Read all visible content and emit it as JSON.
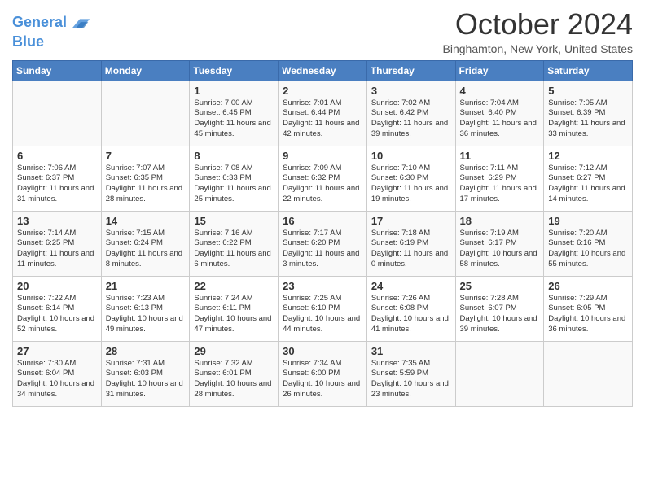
{
  "logo": {
    "line1": "General",
    "line2": "Blue"
  },
  "title": "October 2024",
  "location": "Binghamton, New York, United States",
  "weekdays": [
    "Sunday",
    "Monday",
    "Tuesday",
    "Wednesday",
    "Thursday",
    "Friday",
    "Saturday"
  ],
  "weeks": [
    [
      {
        "day": "",
        "info": ""
      },
      {
        "day": "",
        "info": ""
      },
      {
        "day": "1",
        "info": "Sunrise: 7:00 AM\nSunset: 6:45 PM\nDaylight: 11 hours and 45 minutes."
      },
      {
        "day": "2",
        "info": "Sunrise: 7:01 AM\nSunset: 6:44 PM\nDaylight: 11 hours and 42 minutes."
      },
      {
        "day": "3",
        "info": "Sunrise: 7:02 AM\nSunset: 6:42 PM\nDaylight: 11 hours and 39 minutes."
      },
      {
        "day": "4",
        "info": "Sunrise: 7:04 AM\nSunset: 6:40 PM\nDaylight: 11 hours and 36 minutes."
      },
      {
        "day": "5",
        "info": "Sunrise: 7:05 AM\nSunset: 6:39 PM\nDaylight: 11 hours and 33 minutes."
      }
    ],
    [
      {
        "day": "6",
        "info": "Sunrise: 7:06 AM\nSunset: 6:37 PM\nDaylight: 11 hours and 31 minutes."
      },
      {
        "day": "7",
        "info": "Sunrise: 7:07 AM\nSunset: 6:35 PM\nDaylight: 11 hours and 28 minutes."
      },
      {
        "day": "8",
        "info": "Sunrise: 7:08 AM\nSunset: 6:33 PM\nDaylight: 11 hours and 25 minutes."
      },
      {
        "day": "9",
        "info": "Sunrise: 7:09 AM\nSunset: 6:32 PM\nDaylight: 11 hours and 22 minutes."
      },
      {
        "day": "10",
        "info": "Sunrise: 7:10 AM\nSunset: 6:30 PM\nDaylight: 11 hours and 19 minutes."
      },
      {
        "day": "11",
        "info": "Sunrise: 7:11 AM\nSunset: 6:29 PM\nDaylight: 11 hours and 17 minutes."
      },
      {
        "day": "12",
        "info": "Sunrise: 7:12 AM\nSunset: 6:27 PM\nDaylight: 11 hours and 14 minutes."
      }
    ],
    [
      {
        "day": "13",
        "info": "Sunrise: 7:14 AM\nSunset: 6:25 PM\nDaylight: 11 hours and 11 minutes."
      },
      {
        "day": "14",
        "info": "Sunrise: 7:15 AM\nSunset: 6:24 PM\nDaylight: 11 hours and 8 minutes."
      },
      {
        "day": "15",
        "info": "Sunrise: 7:16 AM\nSunset: 6:22 PM\nDaylight: 11 hours and 6 minutes."
      },
      {
        "day": "16",
        "info": "Sunrise: 7:17 AM\nSunset: 6:20 PM\nDaylight: 11 hours and 3 minutes."
      },
      {
        "day": "17",
        "info": "Sunrise: 7:18 AM\nSunset: 6:19 PM\nDaylight: 11 hours and 0 minutes."
      },
      {
        "day": "18",
        "info": "Sunrise: 7:19 AM\nSunset: 6:17 PM\nDaylight: 10 hours and 58 minutes."
      },
      {
        "day": "19",
        "info": "Sunrise: 7:20 AM\nSunset: 6:16 PM\nDaylight: 10 hours and 55 minutes."
      }
    ],
    [
      {
        "day": "20",
        "info": "Sunrise: 7:22 AM\nSunset: 6:14 PM\nDaylight: 10 hours and 52 minutes."
      },
      {
        "day": "21",
        "info": "Sunrise: 7:23 AM\nSunset: 6:13 PM\nDaylight: 10 hours and 49 minutes."
      },
      {
        "day": "22",
        "info": "Sunrise: 7:24 AM\nSunset: 6:11 PM\nDaylight: 10 hours and 47 minutes."
      },
      {
        "day": "23",
        "info": "Sunrise: 7:25 AM\nSunset: 6:10 PM\nDaylight: 10 hours and 44 minutes."
      },
      {
        "day": "24",
        "info": "Sunrise: 7:26 AM\nSunset: 6:08 PM\nDaylight: 10 hours and 41 minutes."
      },
      {
        "day": "25",
        "info": "Sunrise: 7:28 AM\nSunset: 6:07 PM\nDaylight: 10 hours and 39 minutes."
      },
      {
        "day": "26",
        "info": "Sunrise: 7:29 AM\nSunset: 6:05 PM\nDaylight: 10 hours and 36 minutes."
      }
    ],
    [
      {
        "day": "27",
        "info": "Sunrise: 7:30 AM\nSunset: 6:04 PM\nDaylight: 10 hours and 34 minutes."
      },
      {
        "day": "28",
        "info": "Sunrise: 7:31 AM\nSunset: 6:03 PM\nDaylight: 10 hours and 31 minutes."
      },
      {
        "day": "29",
        "info": "Sunrise: 7:32 AM\nSunset: 6:01 PM\nDaylight: 10 hours and 28 minutes."
      },
      {
        "day": "30",
        "info": "Sunrise: 7:34 AM\nSunset: 6:00 PM\nDaylight: 10 hours and 26 minutes."
      },
      {
        "day": "31",
        "info": "Sunrise: 7:35 AM\nSunset: 5:59 PM\nDaylight: 10 hours and 23 minutes."
      },
      {
        "day": "",
        "info": ""
      },
      {
        "day": "",
        "info": ""
      }
    ]
  ]
}
